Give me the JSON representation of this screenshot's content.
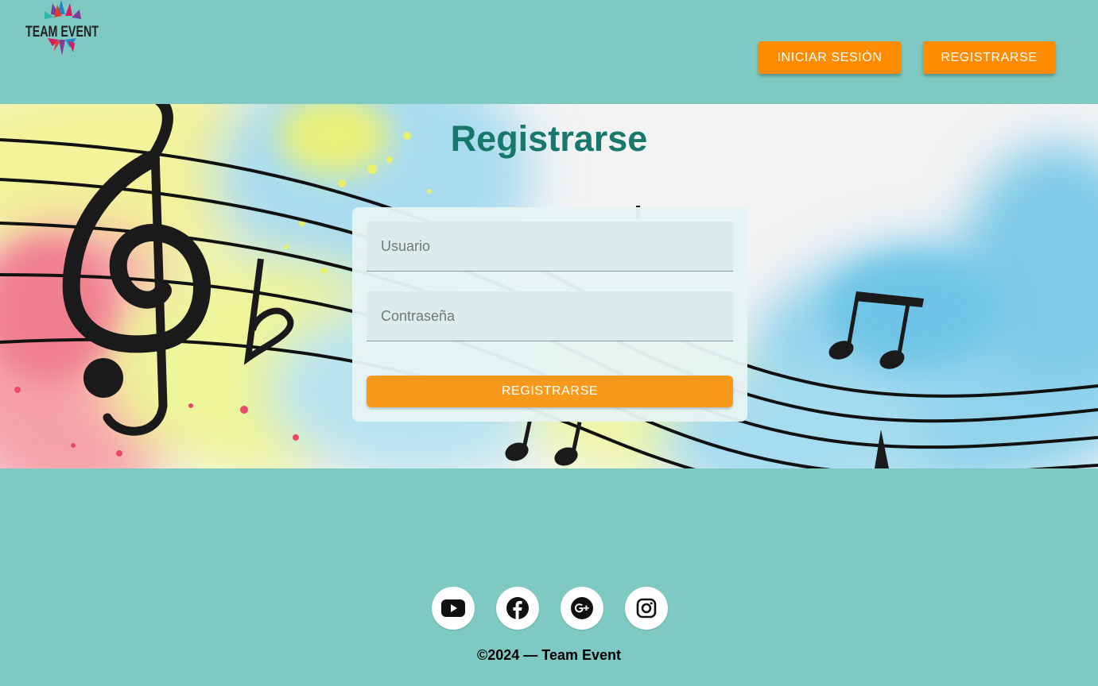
{
  "brand": {
    "logo_text": "TEAM EVENT",
    "logo_icon": "star-burst-logo"
  },
  "nav": {
    "login_label": "INICIAR SESIÓN",
    "register_label": "REGISTRARSE"
  },
  "hero": {
    "title": "Registrarse",
    "background": "watercolor-music-staff"
  },
  "form": {
    "username_placeholder": "Usuario",
    "password_placeholder": "Contraseña",
    "submit_label": "REGISTRARSE"
  },
  "social": [
    {
      "name": "youtube",
      "icon": "youtube-icon"
    },
    {
      "name": "facebook",
      "icon": "facebook-icon"
    },
    {
      "name": "google-plus",
      "icon": "google-plus-icon"
    },
    {
      "name": "instagram",
      "icon": "instagram-icon"
    }
  ],
  "footer": {
    "copyright": "©2024 — Team Event"
  },
  "colors": {
    "page_bg": "#7ecac2",
    "accent": "#ff8c00",
    "title": "#17786b",
    "card_bg": "#e6f4f2"
  }
}
